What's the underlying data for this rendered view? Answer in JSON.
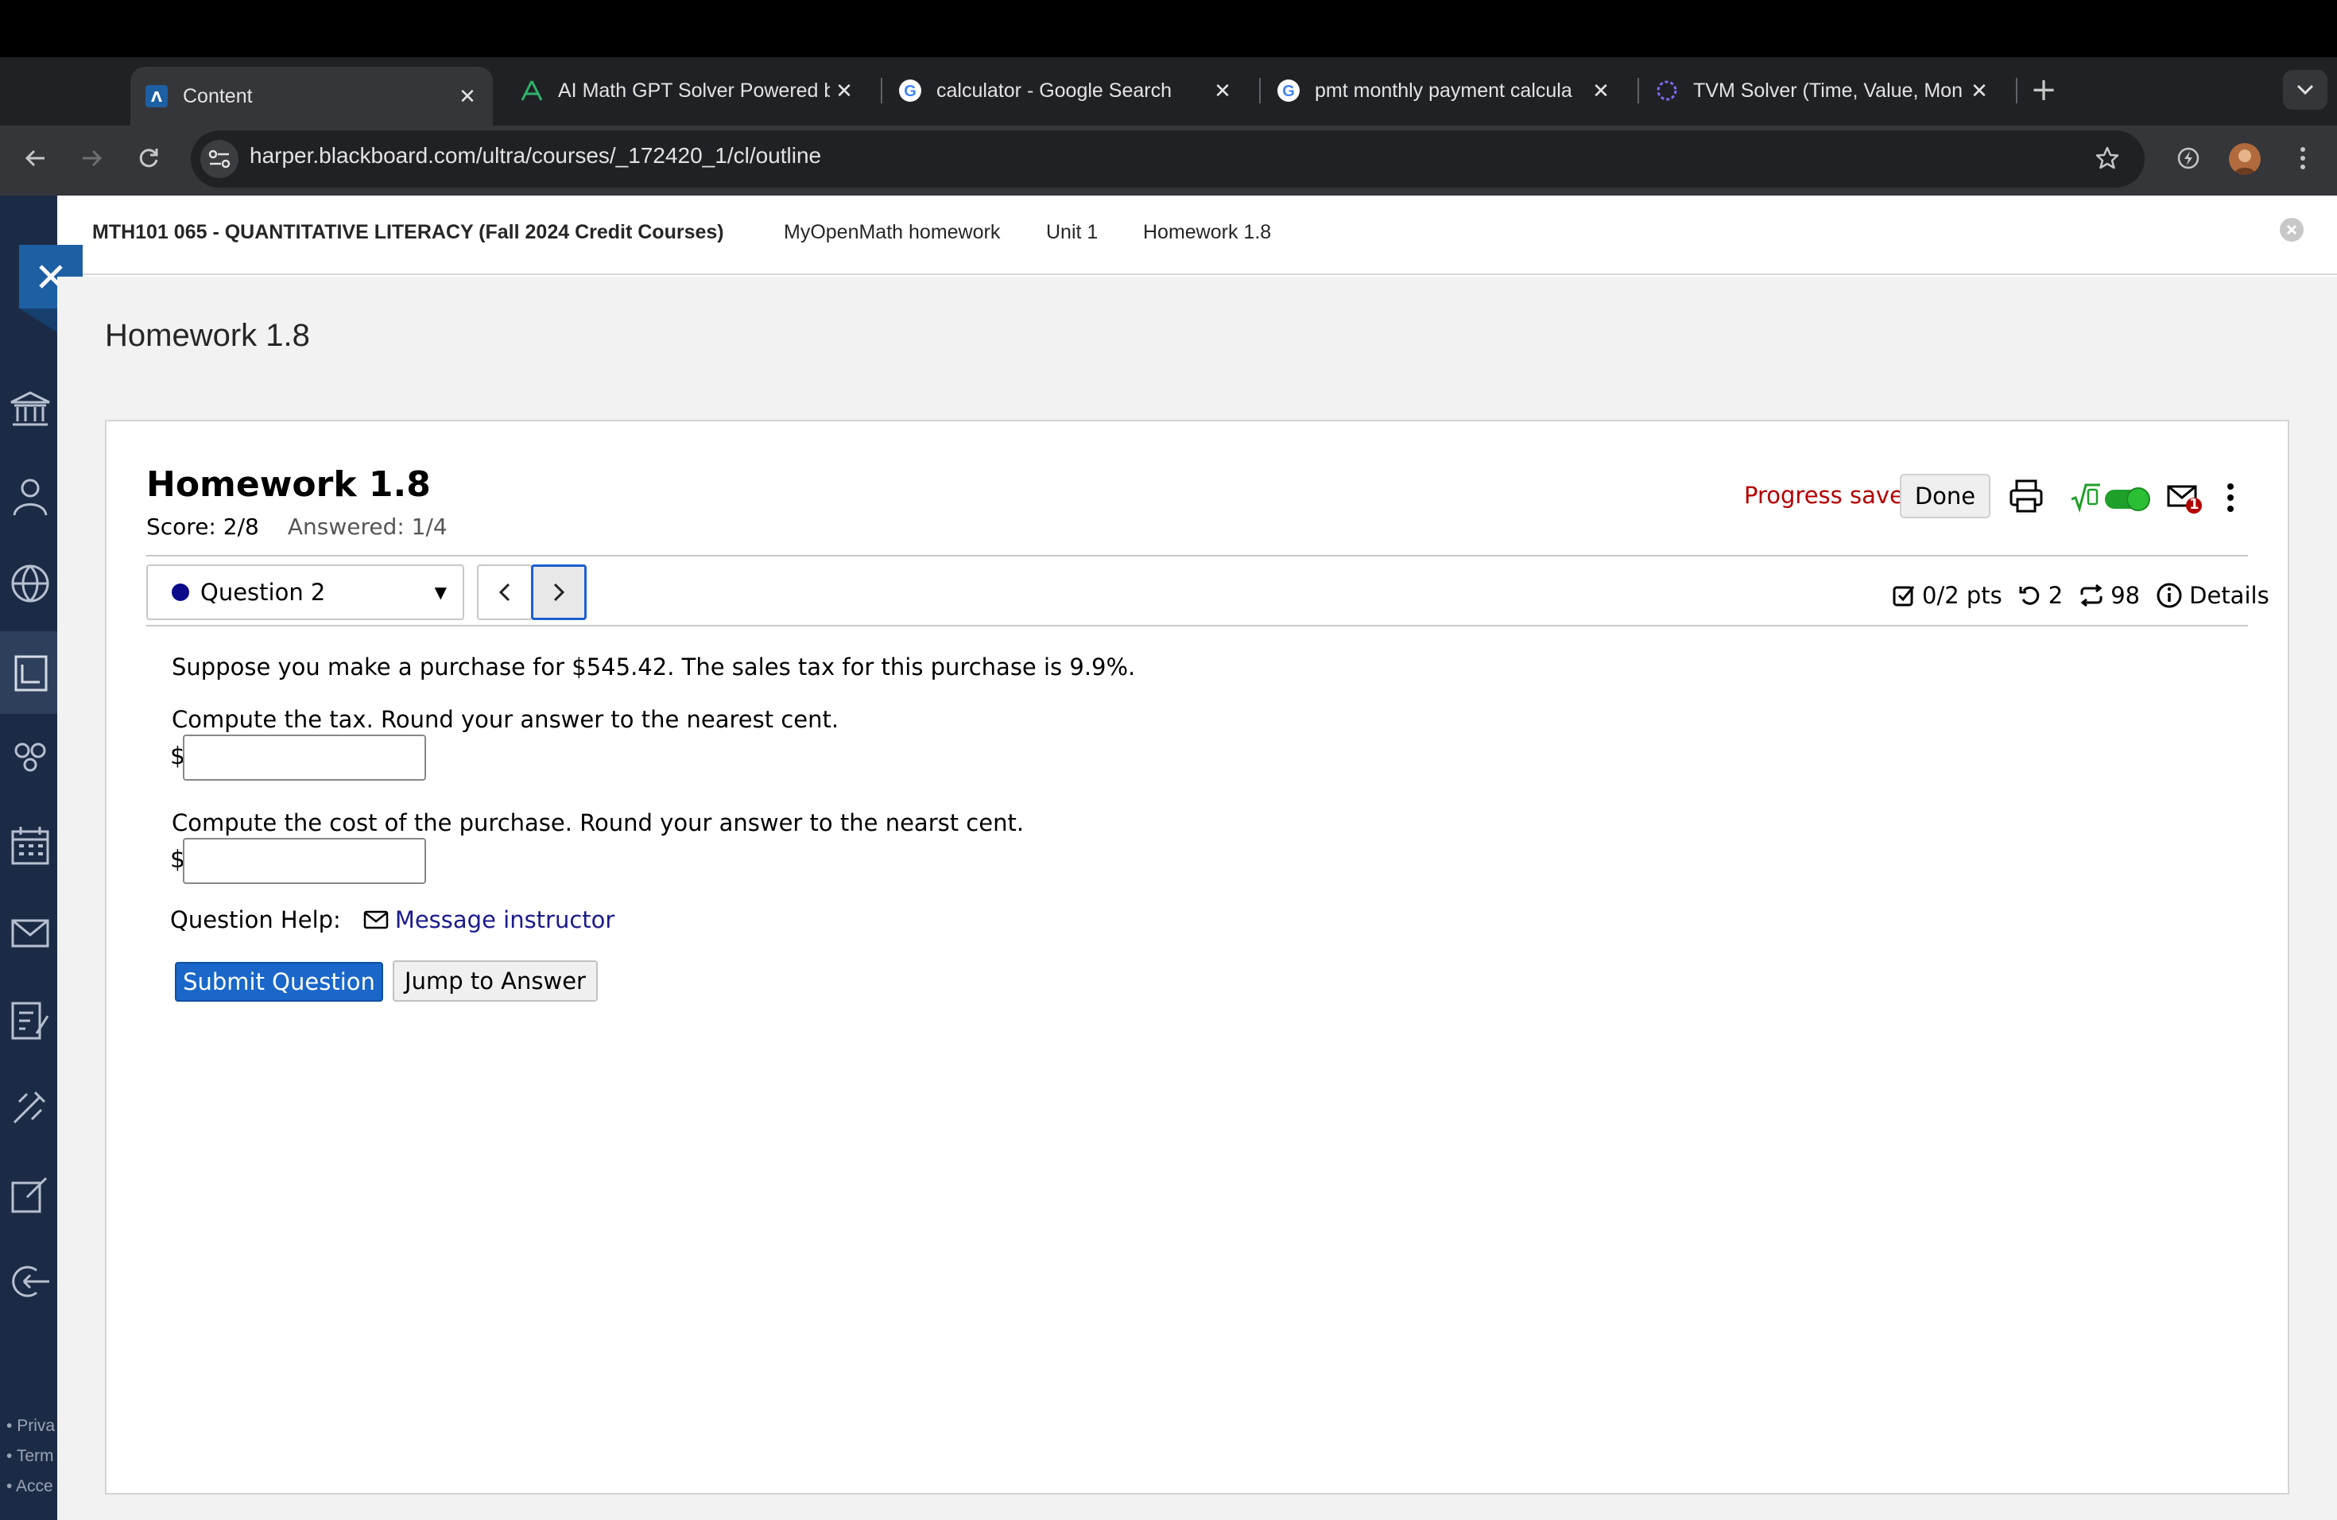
{
  "browser": {
    "tabs": [
      {
        "label": "Content",
        "favicon": "blackboard-icon",
        "active": true
      },
      {
        "label": "AI Math GPT Solver Powered b",
        "favicon": "ai-math-icon",
        "active": false
      },
      {
        "label": "calculator - Google Search",
        "favicon": "google-icon",
        "active": false
      },
      {
        "label": "pmt monthly payment calcula",
        "favicon": "google-icon",
        "active": false
      },
      {
        "label": "TVM Solver (Time, Value, Mon",
        "favicon": "tvm-icon",
        "active": false
      }
    ],
    "tab_close_glyph": "✕",
    "new_tab_glyph": "+",
    "url": "harper.blackboard.com/ultra/courses/_172420_1/cl/outline"
  },
  "blackboard": {
    "course_title": "MTH101 065 - QUANTITATIVE LITERACY (Fall 2024 Credit Courses)",
    "breadcrumbs": [
      "MyOpenMath homework",
      "Unit 1",
      "Homework 1.8"
    ],
    "page_title": "Homework 1.8",
    "footer_links": [
      "Priva",
      "Term",
      "Acce"
    ]
  },
  "assignment": {
    "title": "Homework 1.8",
    "score": "Score: 2/8",
    "answered": "Answered: 1/4",
    "progress_status": "Progress saved",
    "done_label": "Done",
    "question_select": "Question 2",
    "points": "0/2 pts",
    "tries": "2",
    "regens": "98",
    "details_label": "Details",
    "mail_badge": "1"
  },
  "question": {
    "intro": "Suppose you make a purchase for $545.42. The sales tax for this purchase is 9.9%.",
    "part1": "Compute the tax. Round your answer to the nearest cent.",
    "part2": "Compute the cost of the purchase. Round your answer to the nearst cent.",
    "currency": "$",
    "answer1_value": "",
    "answer2_value": "",
    "help_label": "Question Help:",
    "help_link": "Message instructor",
    "submit_label": "Submit Question",
    "jump_label": "Jump to Answer"
  },
  "colors": {
    "accent_blue": "#1a67c9",
    "progress_red": "#b30000",
    "toggle_green": "#1fa02a",
    "rail_navy": "#1c2b45"
  }
}
